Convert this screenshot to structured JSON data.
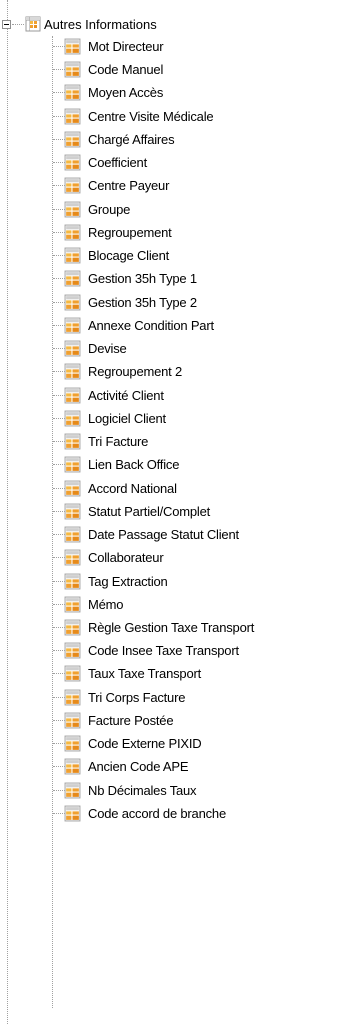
{
  "tree": {
    "root": {
      "label": "Autres Informations",
      "expanded": true,
      "icon": "table-icon"
    },
    "children": [
      {
        "label": "Mot Directeur",
        "icon": "field-icon"
      },
      {
        "label": "Code Manuel",
        "icon": "field-icon"
      },
      {
        "label": "Moyen Accès",
        "icon": "field-icon"
      },
      {
        "label": "Centre Visite Médicale",
        "icon": "field-icon"
      },
      {
        "label": "Chargé Affaires",
        "icon": "field-icon"
      },
      {
        "label": "Coefficient",
        "icon": "field-icon"
      },
      {
        "label": "Centre Payeur",
        "icon": "field-icon"
      },
      {
        "label": "Groupe",
        "icon": "field-icon"
      },
      {
        "label": "Regroupement",
        "icon": "field-icon"
      },
      {
        "label": "Blocage Client",
        "icon": "field-icon"
      },
      {
        "label": "Gestion 35h Type 1",
        "icon": "field-icon"
      },
      {
        "label": "Gestion 35h Type 2",
        "icon": "field-icon"
      },
      {
        "label": "Annexe Condition Part",
        "icon": "field-icon"
      },
      {
        "label": "Devise",
        "icon": "field-icon"
      },
      {
        "label": "Regroupement 2",
        "icon": "field-icon"
      },
      {
        "label": "Activité Client",
        "icon": "field-icon"
      },
      {
        "label": "Logiciel Client",
        "icon": "field-icon"
      },
      {
        "label": "Tri Facture",
        "icon": "field-icon"
      },
      {
        "label": "Lien Back Office",
        "icon": "field-icon"
      },
      {
        "label": "Accord National",
        "icon": "field-icon"
      },
      {
        "label": "Statut Partiel/Complet",
        "icon": "field-icon"
      },
      {
        "label": "Date Passage Statut Client",
        "icon": "field-icon"
      },
      {
        "label": "Collaborateur",
        "icon": "field-icon"
      },
      {
        "label": "Tag Extraction",
        "icon": "field-icon"
      },
      {
        "label": "Mémo",
        "icon": "field-icon"
      },
      {
        "label": "Règle Gestion Taxe Transport",
        "icon": "field-icon"
      },
      {
        "label": "Code Insee Taxe Transport",
        "icon": "field-icon"
      },
      {
        "label": "Taux Taxe Transport",
        "icon": "field-icon"
      },
      {
        "label": "Tri Corps Facture",
        "icon": "field-icon"
      },
      {
        "label": "Facture Postée",
        "icon": "field-icon"
      },
      {
        "label": "Code Externe PIXID",
        "icon": "field-icon"
      },
      {
        "label": "Ancien Code APE",
        "icon": "field-icon"
      },
      {
        "label": "Nb Décimales Taux",
        "icon": "field-icon"
      },
      {
        "label": "Code accord de branche",
        "icon": "field-icon"
      }
    ]
  },
  "colors": {
    "tree_line": "#a0a0a0",
    "icon_orange": "#f0a030",
    "icon_grid": "#ffffff"
  }
}
